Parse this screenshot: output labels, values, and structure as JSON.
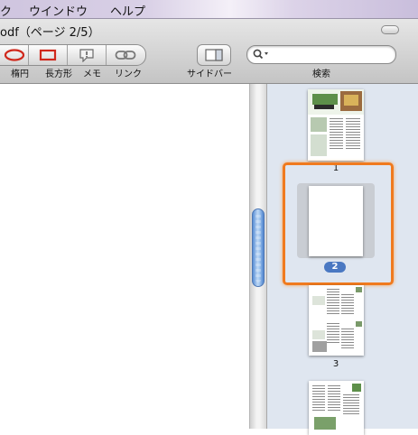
{
  "menubar": {
    "items": [
      "ク",
      "ウインドウ",
      "ヘルプ"
    ]
  },
  "window": {
    "title": "odf（ページ 2/5）"
  },
  "toolbar": {
    "ellipse_label": "楕円",
    "rectangle_label": "長方形",
    "note_label": "メモ",
    "link_label": "リンク",
    "sidebar_label": "サイドバー",
    "search_label": "検索",
    "search_placeholder": ""
  },
  "colors": {
    "selection": "#f07a1e",
    "badge": "#4a78c2",
    "annotation_red": "#d0281c"
  },
  "sidebar": {
    "pages": [
      {
        "number": "1",
        "selected": false
      },
      {
        "number": "2",
        "selected": true
      },
      {
        "number": "3",
        "selected": false
      }
    ]
  }
}
